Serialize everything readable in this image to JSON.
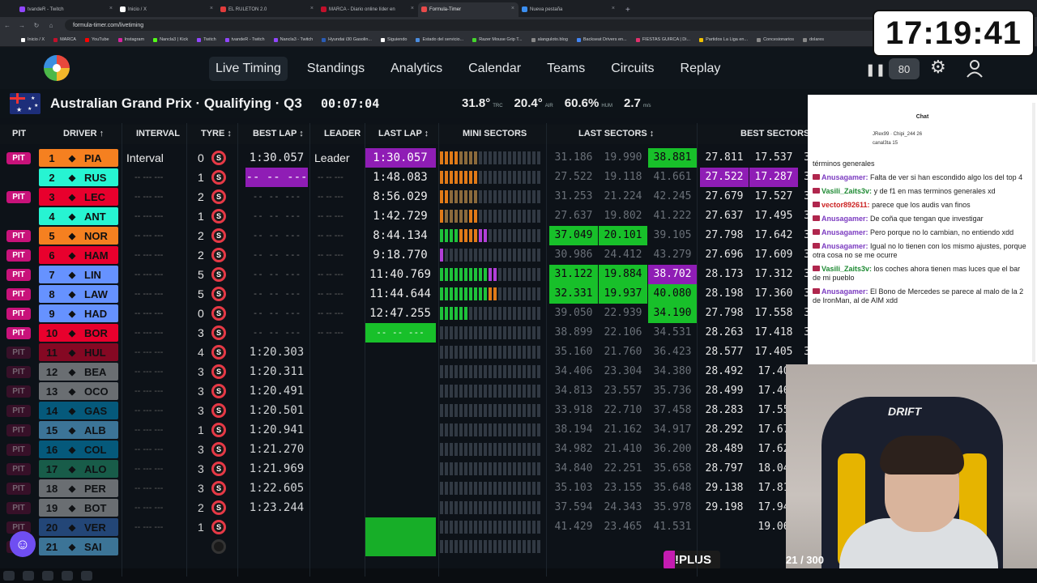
{
  "browser": {
    "tabs": [
      "tvandeR - Twitch",
      "Inicio / X",
      "EL RULETON 2.0",
      "MARCA - Diario online líder en",
      "Formula-Timer",
      "Nueva pestaña"
    ],
    "tab_colors": [
      "#9146ff",
      "#ffffff",
      "#e23b3b",
      "#c2102b",
      "#e84a4a",
      "#3b8ef0"
    ],
    "url": "formula-timer.com/livetiming",
    "bookmarks": [
      "Inicio / X",
      "MARCA",
      "YouTube",
      "Instagram",
      "Nancla3 | Kick",
      "Twitch",
      "tvandeR - Twitch",
      "Nancla3 - Twitch",
      "Hyundai i30 Gasolin...",
      "Siguiendo",
      "Estado del servicio...",
      "Razer Mouse Grip T...",
      "alanguloto.blog",
      "Backseat Drivers en...",
      "FIESTAS GUIRCA | Di...",
      "Partidos La Liga en...",
      "Concesionarios",
      "dolares"
    ]
  },
  "nav": {
    "links": [
      "Live Timing",
      "Standings",
      "Analytics",
      "Calendar",
      "Teams",
      "Circuits",
      "Replay"
    ],
    "speed": "80"
  },
  "clock": "17:19:41",
  "session": {
    "title": "Australian Grand Prix · Qualifying · Q3",
    "elapsed": "00:07:04",
    "trc": "31.8°",
    "trc_unit": "TRC",
    "air": "20.4°",
    "air_unit": "AIR",
    "hum": "60.6%",
    "hum_unit": "HUM",
    "wind": "2.7",
    "wind_unit": "m/s"
  },
  "headers": [
    "PIT",
    "DRIVER ↑",
    "INTERVAL",
    "TYRE ↕",
    "BEST LAP ↕",
    "LEADER",
    "LAST LAP ↕",
    "MINI SECTORS",
    "LAST SECTORS ↕",
    "BEST SECTORS"
  ],
  "rows": [
    {
      "pit": "PIT",
      "pos": "1",
      "code": "PIA",
      "color": "#f58020",
      "interval": "Interval",
      "laps": "0",
      "tyre": "S",
      "best": "1:30.057",
      "leader": "Leader",
      "last": "1:30.057",
      "lastbg": "purple",
      "ls": [
        "31.186",
        "19.990",
        "38.881"
      ],
      "lsc": [
        "grey",
        "grey",
        "green"
      ],
      "bs": [
        "27.811",
        "17.537",
        "3"
      ],
      "bsc": [
        "white",
        "white",
        "white"
      ],
      "ms": "oooowwww"
    },
    {
      "pit": "",
      "pos": "2",
      "code": "RUS",
      "color": "#27f4d2",
      "interval": "-- --- ---",
      "laps": "1",
      "tyre": "S",
      "best": "-- -- ---",
      "bestbg": "purple",
      "leader": "-- -- ---",
      "last": "1:48.083",
      "ls": [
        "27.522",
        "19.118",
        "41.661"
      ],
      "lsc": [
        "grey",
        "grey",
        "grey"
      ],
      "bs": [
        "27.522",
        "17.287",
        "3"
      ],
      "bsc": [
        "purple",
        "purple",
        "white"
      ],
      "ms": "oooooooo"
    },
    {
      "pit": "PIT",
      "pos": "3",
      "code": "LEC",
      "color": "#e8002d",
      "interval": "-- --- ---",
      "laps": "2",
      "tyre": "S",
      "best": "-- -- ---",
      "leader": "-- -- ---",
      "last": "8:56.029",
      "ls": [
        "31.253",
        "21.224",
        "42.245"
      ],
      "lsc": [
        "grey",
        "grey",
        "grey"
      ],
      "bs": [
        "27.679",
        "17.527",
        "3"
      ],
      "bsc": [
        "white",
        "white",
        "white"
      ],
      "ms": "oowwwwww"
    },
    {
      "pit": "",
      "pos": "4",
      "code": "ANT",
      "color": "#27f4d2",
      "interval": "-- --- ---",
      "laps": "1",
      "tyre": "S",
      "best": "-- -- ---",
      "leader": "-- -- ---",
      "last": "1:42.729",
      "ls": [
        "27.637",
        "19.802",
        "41.222"
      ],
      "lsc": [
        "grey",
        "grey",
        "grey"
      ],
      "bs": [
        "27.637",
        "17.495",
        "3"
      ],
      "bsc": [
        "white",
        "white",
        "white"
      ],
      "ms": "owwwwwoo"
    },
    {
      "pit": "PIT",
      "pos": "5",
      "code": "NOR",
      "color": "#f58020",
      "interval": "-- --- ---",
      "laps": "2",
      "tyre": "S",
      "best": "-- -- ---",
      "leader": "-- -- ---",
      "last": "8:44.134",
      "ls": [
        "37.049",
        "20.101",
        "39.105"
      ],
      "lsc": [
        "green",
        "green",
        "grey"
      ],
      "bs": [
        "27.798",
        "17.642",
        "3"
      ],
      "bsc": [
        "white",
        "white",
        "white"
      ],
      "ms": "ggggoooopp"
    },
    {
      "pit": "PIT",
      "pos": "6",
      "code": "HAM",
      "color": "#e8002d",
      "interval": "-- --- ---",
      "laps": "2",
      "tyre": "S",
      "best": "-- -- ---",
      "leader": "-- -- ---",
      "last": "9:18.770",
      "ls": [
        "30.986",
        "24.412",
        "43.279"
      ],
      "lsc": [
        "grey",
        "grey",
        "grey"
      ],
      "bs": [
        "27.696",
        "17.609",
        "3"
      ],
      "bsc": [
        "white",
        "white",
        "white"
      ],
      "ms": "p"
    },
    {
      "pit": "PIT",
      "pos": "7",
      "code": "LIN",
      "color": "#6692ff",
      "interval": "-- --- ---",
      "laps": "5",
      "tyre": "S",
      "best": "-- -- ---",
      "leader": "-- -- ---",
      "last": "11:40.769",
      "ls": [
        "31.122",
        "19.884",
        "38.702"
      ],
      "lsc": [
        "green",
        "green",
        "purple"
      ],
      "bs": [
        "28.173",
        "17.312",
        "3"
      ],
      "bsc": [
        "white",
        "white",
        "white"
      ],
      "ms": "ggggggggggpp"
    },
    {
      "pit": "PIT",
      "pos": "8",
      "code": "LAW",
      "color": "#6692ff",
      "interval": "-- --- ---",
      "laps": "5",
      "tyre": "S",
      "best": "-- -- ---",
      "leader": "-- -- ---",
      "last": "11:44.644",
      "ls": [
        "32.331",
        "19.937",
        "40.080"
      ],
      "lsc": [
        "green",
        "green",
        "green"
      ],
      "bs": [
        "28.198",
        "17.360",
        "3"
      ],
      "bsc": [
        "white",
        "white",
        "white"
      ],
      "ms": "ggggggggggoo"
    },
    {
      "pit": "PIT",
      "pos": "9",
      "code": "HAD",
      "color": "#6692ff",
      "interval": "-- --- ---",
      "laps": "0",
      "tyre": "S",
      "best": "-- -- ---",
      "leader": "-- -- ---",
      "last": "12:47.255",
      "ls": [
        "39.050",
        "22.939",
        "34.190"
      ],
      "lsc": [
        "grey",
        "grey",
        "green"
      ],
      "bs": [
        "27.798",
        "17.558",
        "3"
      ],
      "bsc": [
        "white",
        "white",
        "white"
      ],
      "ms": "gggggg"
    },
    {
      "pit": "PIT",
      "pos": "10",
      "code": "BOR",
      "color": "#e8002d",
      "interval": "-- --- ---",
      "laps": "3",
      "tyre": "S",
      "best": "-- -- ---",
      "leader": "-- -- ---",
      "last": "-- -- ---",
      "lastbg": "green",
      "ls": [
        "38.899",
        "22.106",
        "34.531"
      ],
      "lsc": [
        "grey",
        "grey",
        "grey"
      ],
      "bs": [
        "28.263",
        "17.418",
        "3"
      ],
      "bsc": [
        "white",
        "white",
        "white"
      ],
      "ms": ""
    },
    {
      "pit": "PIT",
      "pos": "11",
      "code": "HUL",
      "color": "#e8002d",
      "interval": "-- --- ---",
      "laps": "4",
      "tyre": "S",
      "best": "1:20.303",
      "leader": "",
      "last": "",
      "ls": [
        "35.160",
        "21.760",
        "36.423"
      ],
      "lsc": [
        "grey",
        "grey",
        "grey"
      ],
      "bs": [
        "28.577",
        "17.405",
        "3"
      ],
      "bsc": [
        "white",
        "white",
        "white"
      ],
      "ms": "",
      "dim": true
    },
    {
      "pit": "PIT",
      "pos": "12",
      "code": "BEA",
      "color": "#b6babd",
      "interval": "-- --- ---",
      "laps": "3",
      "tyre": "S",
      "best": "1:20.311",
      "leader": "",
      "last": "",
      "ls": [
        "34.406",
        "23.304",
        "34.380"
      ],
      "lsc": [
        "grey",
        "grey",
        "grey"
      ],
      "bs": [
        "28.492",
        "17.40",
        "3"
      ],
      "bsc": [
        "white",
        "white",
        "white"
      ],
      "ms": "",
      "dim": true
    },
    {
      "pit": "PIT",
      "pos": "13",
      "code": "OCO",
      "color": "#b6babd",
      "interval": "-- --- ---",
      "laps": "3",
      "tyre": "S",
      "best": "1:20.491",
      "leader": "",
      "last": "",
      "ls": [
        "34.813",
        "23.557",
        "35.736"
      ],
      "lsc": [
        "grey",
        "grey",
        "grey"
      ],
      "bs": [
        "28.499",
        "17.46",
        "3"
      ],
      "bsc": [
        "white",
        "white",
        "white"
      ],
      "ms": "",
      "dim": true
    },
    {
      "pit": "PIT",
      "pos": "14",
      "code": "GAS",
      "color": "#0093cc",
      "interval": "-- --- ---",
      "laps": "3",
      "tyre": "S",
      "best": "1:20.501",
      "leader": "",
      "last": "",
      "ls": [
        "33.918",
        "22.710",
        "37.458"
      ],
      "lsc": [
        "grey",
        "grey",
        "grey"
      ],
      "bs": [
        "28.283",
        "17.55",
        "3"
      ],
      "bsc": [
        "white",
        "white",
        "white"
      ],
      "ms": "",
      "dim": true
    },
    {
      "pit": "PIT",
      "pos": "15",
      "code": "ALB",
      "color": "#64c4ff",
      "interval": "-- --- ---",
      "laps": "1",
      "tyre": "S",
      "best": "1:20.941",
      "leader": "",
      "last": "",
      "ls": [
        "38.194",
        "21.162",
        "34.917"
      ],
      "lsc": [
        "grey",
        "grey",
        "grey"
      ],
      "bs": [
        "28.292",
        "17.67",
        "3"
      ],
      "bsc": [
        "white",
        "white",
        "white"
      ],
      "ms": "",
      "dim": true
    },
    {
      "pit": "PIT",
      "pos": "16",
      "code": "COL",
      "color": "#0093cc",
      "interval": "-- --- ---",
      "laps": "3",
      "tyre": "S",
      "best": "1:21.270",
      "leader": "",
      "last": "",
      "ls": [
        "34.982",
        "21.410",
        "36.200"
      ],
      "lsc": [
        "grey",
        "grey",
        "grey"
      ],
      "bs": [
        "28.489",
        "17.62",
        "3"
      ],
      "bsc": [
        "white",
        "white",
        "white"
      ],
      "ms": "",
      "dim": true
    },
    {
      "pit": "PIT",
      "pos": "17",
      "code": "ALO",
      "color": "#229971",
      "interval": "-- --- ---",
      "laps": "3",
      "tyre": "S",
      "best": "1:21.969",
      "leader": "",
      "last": "",
      "ls": [
        "34.840",
        "22.251",
        "35.658"
      ],
      "lsc": [
        "grey",
        "grey",
        "grey"
      ],
      "bs": [
        "28.797",
        "18.04",
        "3"
      ],
      "bsc": [
        "white",
        "white",
        "white"
      ],
      "ms": "",
      "dim": true
    },
    {
      "pit": "PIT",
      "pos": "18",
      "code": "PER",
      "color": "#b6babd",
      "interval": "-- --- ---",
      "laps": "3",
      "tyre": "S",
      "best": "1:22.605",
      "leader": "",
      "last": "",
      "ls": [
        "35.103",
        "23.155",
        "35.648"
      ],
      "lsc": [
        "grey",
        "grey",
        "grey"
      ],
      "bs": [
        "29.138",
        "17.81",
        "3"
      ],
      "bsc": [
        "white",
        "white",
        "white"
      ],
      "ms": "",
      "dim": true
    },
    {
      "pit": "PIT",
      "pos": "19",
      "code": "BOT",
      "color": "#b6babd",
      "interval": "-- --- ---",
      "laps": "2",
      "tyre": "S",
      "best": "1:23.244",
      "leader": "",
      "last": "",
      "ls": [
        "37.594",
        "24.343",
        "35.978"
      ],
      "lsc": [
        "grey",
        "grey",
        "grey"
      ],
      "bs": [
        "29.198",
        "17.94",
        "3"
      ],
      "bsc": [
        "white",
        "white",
        "white"
      ],
      "ms": "",
      "dim": true
    },
    {
      "pit": "PIT",
      "pos": "20",
      "code": "VER",
      "color": "#3671c6",
      "interval": "-- --- ---",
      "laps": "1",
      "tyre": "S",
      "best": "",
      "leader": "",
      "last": "",
      "lastbg": "green",
      "ls": [
        "41.429",
        "23.465",
        "41.531"
      ],
      "lsc": [
        "grey",
        "grey",
        "grey"
      ],
      "bs": [
        "",
        "19.06",
        "3"
      ],
      "bsc": [
        "white",
        "white",
        "white"
      ],
      "ms": "",
      "dim": true
    },
    {
      "pit": "PIT",
      "pos": "21",
      "code": "SAI",
      "color": "#64c4ff",
      "interval": "",
      "laps": "",
      "tyre": "",
      "best": "",
      "leader": "",
      "last": "",
      "lastbg": "green",
      "ls": [
        "",
        "",
        ""
      ],
      "lsc": [
        "grey",
        "grey",
        "grey"
      ],
      "bs": [
        "",
        "",
        ""
      ],
      "bsc": [
        "white",
        "white",
        "white"
      ],
      "ms": "",
      "dim": true
    }
  ],
  "chat": {
    "title": "Chat",
    "pinned": [
      "JRex99 · Chipi_244 26",
      "canal3ta 15"
    ],
    "messages": [
      {
        "name": "",
        "text": "términos generales"
      },
      {
        "name": "Anusagamer:",
        "text": "Falta de ver si han escondido algo los del top 4",
        "c": ""
      },
      {
        "name": "Vasili_Zaits3v:",
        "text": "y de f1 en mas terminos generales xd",
        "c": "g"
      },
      {
        "name": "vector892611:",
        "text": "parece que los audis van finos",
        "c": "r"
      },
      {
        "name": "Anusagamer:",
        "text": "De coña que tengan que investigar",
        "c": ""
      },
      {
        "name": "Anusagamer:",
        "text": "Pero porque no lo cambian, no entiendo xdd",
        "c": ""
      },
      {
        "name": "Anusagamer:",
        "text": "Igual no lo tienen con los mismo ajustes, porque otra cosa no se me ocurre",
        "c": ""
      },
      {
        "name": "Vasili_Zaits3v:",
        "text": "los coches ahora tienen mas luces que el bar de mi pueblo",
        "c": "g"
      },
      {
        "name": "Anusagamer:",
        "text": "El Bono de Mercedes se parece al malo de la 2 de IronMan, al de AIM xdd",
        "c": ""
      }
    ]
  },
  "webcam": {
    "chair_brand": "DRIFT"
  },
  "overlay": {
    "plus": "!PLUS",
    "counter": "21 / 300"
  }
}
